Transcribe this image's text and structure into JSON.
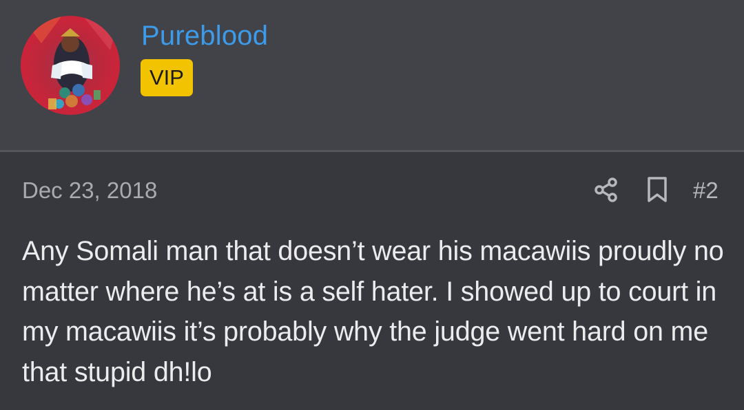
{
  "user": {
    "name": "Pureblood",
    "badge": "VIP",
    "avatar_alt": "avatar"
  },
  "post": {
    "date": "Dec 23, 2018",
    "number": "#2",
    "body": "Any Somali man that doesn’t wear his macawiis proudly no matter where he’s at is a self hater. I showed up to court in my macawiis it’s probably why the judge went hard on me that stupid dh!lo"
  },
  "icons": {
    "share": "share-icon",
    "bookmark": "bookmark-icon"
  },
  "colors": {
    "username": "#3d9be9",
    "badge_bg": "#f2c301",
    "header_bg": "#414349",
    "body_bg": "#36383d",
    "text": "#ececee",
    "muted": "#a9abb1"
  }
}
